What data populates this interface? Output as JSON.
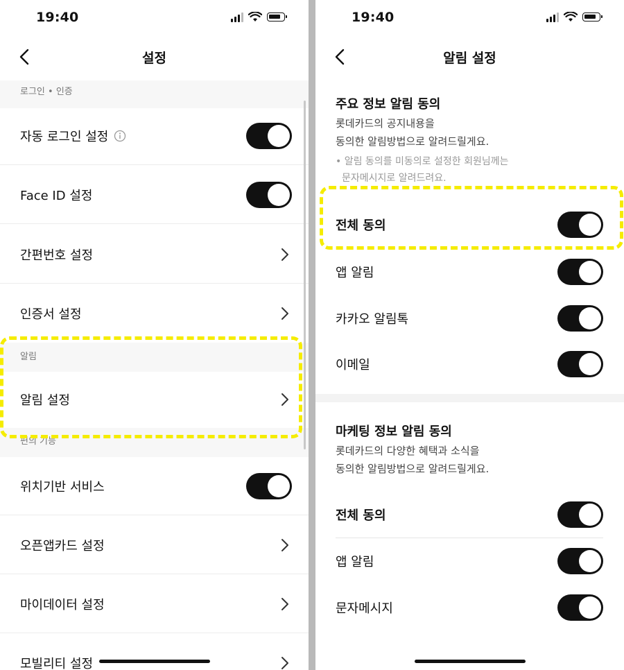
{
  "status_bar": {
    "time": "19:40"
  },
  "left": {
    "title": "설정",
    "section_login": "로그인 • 인증",
    "rows_login": [
      {
        "label": "자동 로그인 설정",
        "control": "toggle",
        "on": true,
        "info_icon": true
      },
      {
        "label": "Face ID 설정",
        "control": "toggle",
        "on": true
      },
      {
        "label": "간편번호 설정",
        "control": "chevron"
      },
      {
        "label": "인증서 설정",
        "control": "chevron"
      }
    ],
    "section_notice": "알림",
    "rows_notice": [
      {
        "label": "알림 설정",
        "control": "chevron"
      }
    ],
    "section_convenience": "편의 기능",
    "rows_convenience": [
      {
        "label": "위치기반 서비스",
        "control": "toggle",
        "on": true
      },
      {
        "label": "오픈앱카드 설정",
        "control": "chevron"
      },
      {
        "label": "마이데이터 설정",
        "control": "chevron"
      },
      {
        "label": "모빌리티 설정",
        "control": "chevron"
      }
    ]
  },
  "right": {
    "title": "알림 설정",
    "main_info": {
      "title": "주요 정보 알림 동의",
      "desc_line1": "롯데카드의 공지내용을",
      "desc_line2": "동의한 알림방법으로 알려드릴게요.",
      "note_line1": "• 알림 동의를 미동의로 설정한 회원님께는",
      "note_line2": "문자메시지로 알려드려요.",
      "rows": [
        {
          "label": "전체 동의",
          "on": true
        },
        {
          "label": "앱 알림",
          "on": true
        },
        {
          "label": "카카오 알림톡",
          "on": true
        },
        {
          "label": "이메일",
          "on": true
        }
      ]
    },
    "marketing": {
      "title": "마케팅 정보 알림 동의",
      "desc_line1": "롯데카드의 다양한 혜택과 소식을",
      "desc_line2": "동의한 알림방법으로 알려드릴게요.",
      "rows": [
        {
          "label": "전체 동의",
          "on": true
        },
        {
          "label": "앱 알림",
          "on": true
        },
        {
          "label": "문자메시지",
          "on": true
        }
      ]
    }
  },
  "colors": {
    "highlight": "#f5ec00",
    "toggle_on": "#111111",
    "section_bg": "#f7f7f7"
  }
}
